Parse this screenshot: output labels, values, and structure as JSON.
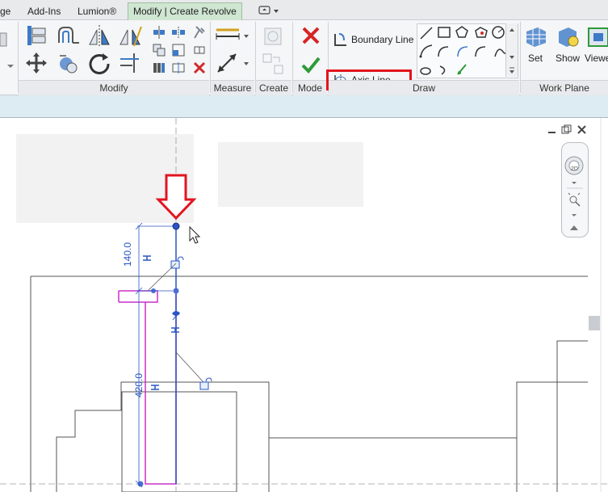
{
  "tabs": [
    {
      "label": "ge"
    },
    {
      "label": "Add-Ins"
    },
    {
      "label": "Lumion®"
    },
    {
      "label": "Modify | Create Revolve",
      "active": true
    }
  ],
  "ribbon": {
    "panels": {
      "modify": "Modify",
      "measure": "Measure",
      "create": "Create",
      "mode": "Mode",
      "draw": "Draw",
      "work_plane": "Work Plane"
    },
    "draw": {
      "boundary_line": "Boundary Line",
      "axis_line": "Axis Line"
    },
    "work_plane": {
      "set": "Set",
      "show": "Show",
      "viewer": "Viewe"
    }
  },
  "canvas": {
    "dimension_1": "140.0",
    "dimension_2": "420.0"
  },
  "colors": {
    "highlight": "#e2151f",
    "sketch_line": "#c830c8",
    "selected_line": "#2a55c4",
    "active_tab": "#cfe6d2"
  }
}
